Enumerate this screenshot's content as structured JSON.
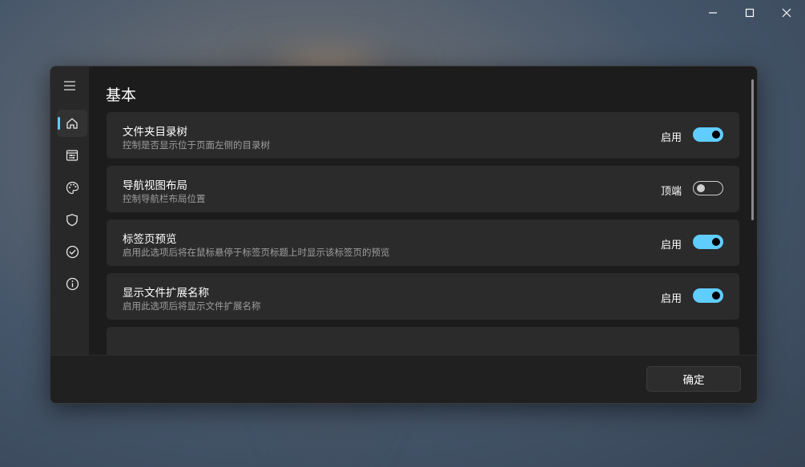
{
  "window": {
    "controls": [
      "minimize-icon",
      "maximize-icon",
      "close-icon"
    ]
  },
  "sidebar": {
    "menu_icon": "hamburger-icon",
    "items": [
      {
        "icon": "home-icon",
        "active": true
      },
      {
        "icon": "settings-list-icon",
        "active": false
      },
      {
        "icon": "palette-icon",
        "active": false
      },
      {
        "icon": "shield-icon",
        "active": false
      },
      {
        "icon": "check-circle-icon",
        "active": false
      },
      {
        "icon": "info-icon",
        "active": false
      }
    ]
  },
  "main": {
    "title": "基本",
    "settings": [
      {
        "title": "文件夹目录树",
        "description": "控制是否显示位于页面左侧的目录树",
        "state": "启用",
        "on": true
      },
      {
        "title": "导航视图布局",
        "description": "控制导航栏布局位置",
        "state": "顶端",
        "on": false
      },
      {
        "title": "标签页预览",
        "description": "启用此选项后将在鼠标悬停于标签页标题上时显示该标签页的预览",
        "state": "启用",
        "on": true
      },
      {
        "title": "显示文件扩展名称",
        "description": "启用此选项后将显示文件扩展名称",
        "state": "启用",
        "on": true
      }
    ]
  },
  "footer": {
    "ok_label": "确定"
  },
  "colors": {
    "accent": "#60cdff",
    "panel": "#202020",
    "card": "#2b2b2b"
  }
}
